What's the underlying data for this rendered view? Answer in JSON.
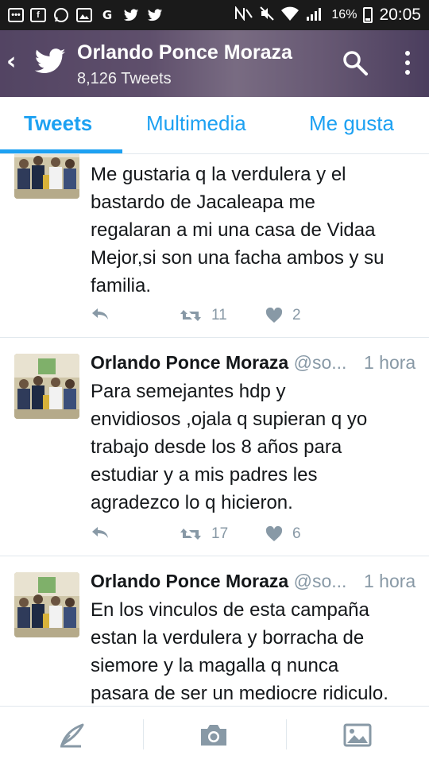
{
  "status_bar": {
    "battery": "16%",
    "time": "20:05"
  },
  "header": {
    "title": "Orlando Ponce Moraza",
    "subtitle": "8,126 Tweets"
  },
  "tabs": [
    {
      "label": "Tweets",
      "active": true
    },
    {
      "label": "Multimedia",
      "active": false
    },
    {
      "label": "Me gusta",
      "active": false
    }
  ],
  "tweets": [
    {
      "name": "",
      "handle": "",
      "time": "",
      "lines": [
        "Me gustaria q la verdulera y el",
        "bastardo de Jacaleapa me",
        "regalaran a mi una casa de Vidaa",
        "Mejor,si son una facha ambos y su",
        "familia."
      ],
      "retweets": "11",
      "likes": "2"
    },
    {
      "name": "Orlando Ponce Moraza",
      "handle": "@so...",
      "time": "1 hora",
      "lines": [
        "Para semejantes hdp y",
        "envidiosos ,ojala q supieran q yo",
        "trabajo desde los 8 años para",
        "estudiar y a mis padres les",
        "agradezco lo q hicieron."
      ],
      "retweets": "17",
      "likes": "6"
    },
    {
      "name": "Orlando Ponce Moraza",
      "handle": "@so...",
      "time": "1 hora",
      "lines": [
        "En los vinculos de esta campaña",
        "estan la verdulera y borracha  de",
        "siemore y la magalla  q nunca",
        "pasara de ser un mediocre ridiculo."
      ],
      "retweets": "",
      "likes": ""
    }
  ],
  "colors": {
    "accent": "#1da1f2",
    "muted": "#8899a6",
    "text": "#14171a"
  }
}
